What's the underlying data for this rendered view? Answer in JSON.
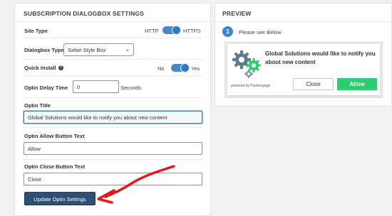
{
  "settings": {
    "title": "SUBSCRIPTION DIALOGBOX SETTINGS",
    "site_type": {
      "label": "Site Type",
      "off_label": "HTTP",
      "on_label": "HTTPS",
      "value": "HTTPS"
    },
    "dialogbox_type": {
      "label": "Dialogbox Type",
      "selected": "Safari Style Box"
    },
    "quick_install": {
      "label": "Quick Install",
      "help": "?",
      "off_label": "No",
      "on_label": "Yes",
      "value": "Yes"
    },
    "optin_delay": {
      "label": "Optin Delay Time",
      "value": "0",
      "unit": "Seconds"
    },
    "optin_title": {
      "label": "Optin Title",
      "value": "Global Solutions would like to notify you about new content"
    },
    "allow_text": {
      "label": "Optin Allow Button Text",
      "value": "Allow"
    },
    "close_text": {
      "label": "Optin Close Button Text",
      "value": "Close"
    },
    "update_button": "Update Optin Settings"
  },
  "preview": {
    "title": "PREVIEW",
    "step_number": "1",
    "step_text": "Please see Below",
    "dialog": {
      "message": "Global Solutions would like to notify you about new content",
      "powered_by": "powered by Pushengage",
      "close_label": "Close",
      "allow_label": "Allow",
      "icon": "gears-icon"
    }
  },
  "annotation": {
    "icon": "red-arrow-icon",
    "color": "#e0191c"
  },
  "colors": {
    "accent": "#2e78c5",
    "button": "#2c4f76",
    "allow": "#2ecc71"
  }
}
